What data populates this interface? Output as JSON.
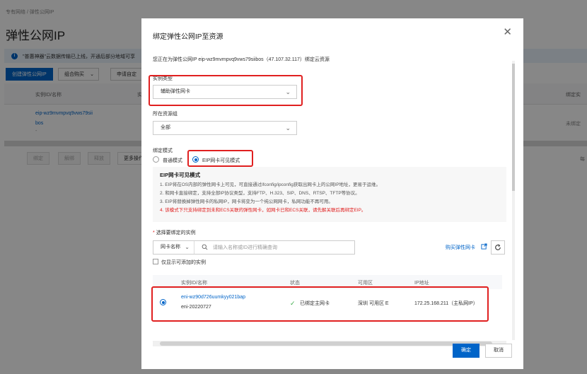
{
  "background": {
    "breadcrumb": "专有网络 / 弹性公网IP",
    "title": "弹性公网IP",
    "notice": "\"普惠神器\"云数据传输已上线，开通后部分地域可享",
    "buttons": [
      "创建弹性公网IP",
      "组合购买",
      "申请自定"
    ],
    "table_headers": [
      "实例ID/名称",
      "实"
    ],
    "right_header": "绑定实",
    "row": {
      "id": "eip-wz9mvmpvq9vws79sii",
      "id2": "bos",
      "dash": "-",
      "right": "未绑定"
    },
    "bottom_buttons": [
      "绑定",
      "解绑",
      "释放",
      "更多操作"
    ],
    "bottom_right": "每"
  },
  "dialog": {
    "title": "绑定弹性公网IP至资源",
    "intro": "您正在为弹性公网IP eip-wz9mvmpvq9vws79siibos（47.107.32.117）绑定云资源",
    "instance_type": {
      "label": "实例类型",
      "value": "辅助弹性网卡"
    },
    "resource_group": {
      "label": "所在资源组",
      "value": "全部"
    },
    "bind_mode": {
      "label": "绑定模式",
      "options": [
        {
          "label": "普通模式",
          "checked": false
        },
        {
          "label": "EIP网卡可见模式",
          "checked": true
        }
      ]
    },
    "info": {
      "title": "EIP网卡可见模式",
      "lines": [
        "1. EIP将在OS内部的弹性网卡上可见，可直接通过ifconfig/ipconfig获取出网卡上的公网IP地址，更易于运维。",
        "2. 和网卡直接绑定，支持全部IP协议类型，支持FTP、H.323、SIP、DNS、RTSP、TFTP等协议。",
        "3. EIP将替换掉弹性网卡的私网IP，网卡将变为一个纯公网网卡，私网功能不再可用。"
      ],
      "warning": "4. 该模式下只支持绑定到未和ECS关联的弹性网卡，如网卡已和ECS关联，请先解关联后再绑定EIP。"
    },
    "select_instance": {
      "required_mark": "*",
      "label": "选择要绑定的实例",
      "search_type": "网卡名称",
      "search_placeholder": "请输入名称或ID进行精确查询",
      "buy_link": "购买弹性网卡",
      "only_addable": "仅显示可添加的实例"
    },
    "table": {
      "headers": [
        "实例ID/名称",
        "状态",
        "可用区",
        "IP地址"
      ],
      "row": {
        "id": "eni-wz90d726uumkyy021bap",
        "name": "eni-20220727",
        "status": "已绑定主网卡",
        "zone": "深圳 可用区 E",
        "ip": "172.25.168.211（主私网IP）"
      }
    },
    "ok_label": "确定",
    "cancel_label": "取消"
  },
  "colors": {
    "primary": "#0064c8",
    "annotation": "#e02020",
    "success": "#3dab4b"
  }
}
